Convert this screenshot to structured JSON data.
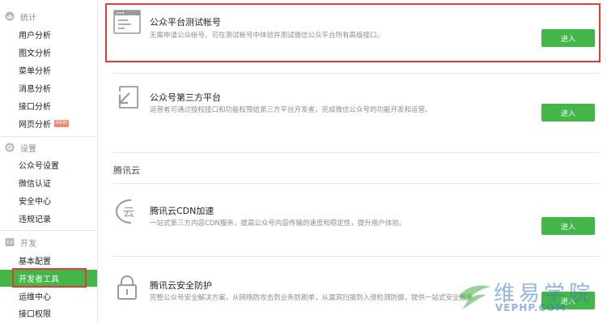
{
  "sidebar": {
    "groups": [
      {
        "title": "统计",
        "icon": "chart-icon",
        "items": [
          {
            "label": "用户分析"
          },
          {
            "label": "图文分析"
          },
          {
            "label": "菜单分析"
          },
          {
            "label": "消息分析"
          },
          {
            "label": "接口分析"
          },
          {
            "label": "网页分析",
            "badge": "NEW"
          }
        ]
      },
      {
        "title": "设置",
        "icon": "gear-icon",
        "items": [
          {
            "label": "公众号设置"
          },
          {
            "label": "微信认证"
          },
          {
            "label": "安全中心"
          },
          {
            "label": "违规记录"
          }
        ]
      },
      {
        "title": "开发",
        "icon": "code-icon",
        "items": [
          {
            "label": "基本配置"
          },
          {
            "label": "开发者工具",
            "active": true
          },
          {
            "label": "运维中心"
          },
          {
            "label": "接口权限"
          }
        ]
      }
    ]
  },
  "main": {
    "cards": [
      {
        "title": "公众平台测试帐号",
        "desc": "无需申请公众帐号、可在测试帐号中体验并测试微信公众平台所有高级接口。",
        "button": "进入",
        "icon": "browser-window-icon"
      },
      {
        "title": "公众号第三方平台",
        "desc": "运营者可通过授权接口和功能权限给第三方平台开发者，完成微信公众号的功能开发和运营。",
        "button": "进入",
        "icon": "authorize-arrow-icon"
      }
    ],
    "section_title": "腾讯云",
    "cloud_cards": [
      {
        "title": "腾讯云CDN加速",
        "desc": "一站式第三方内容CDN服务，提高公众号内容传输的速度和稳定性，提升用户体验。",
        "button": "进入",
        "icon": "cloud-icon"
      },
      {
        "title": "腾讯云安全防护",
        "desc": "完整公众号安全解决方案，从网络防攻击到业务防刷单，从漏洞扫描到入侵检测防御，提供一站式安全服务",
        "button": "进入",
        "icon": "lock-icon"
      }
    ]
  },
  "watermark": {
    "cn": "维易学院",
    "en": "VEPHP.COM"
  },
  "colors": {
    "accent": "#44b549",
    "highlight_border": "#e33a3a",
    "muted_text": "#8d8d8d",
    "border": "#e7e7eb"
  }
}
